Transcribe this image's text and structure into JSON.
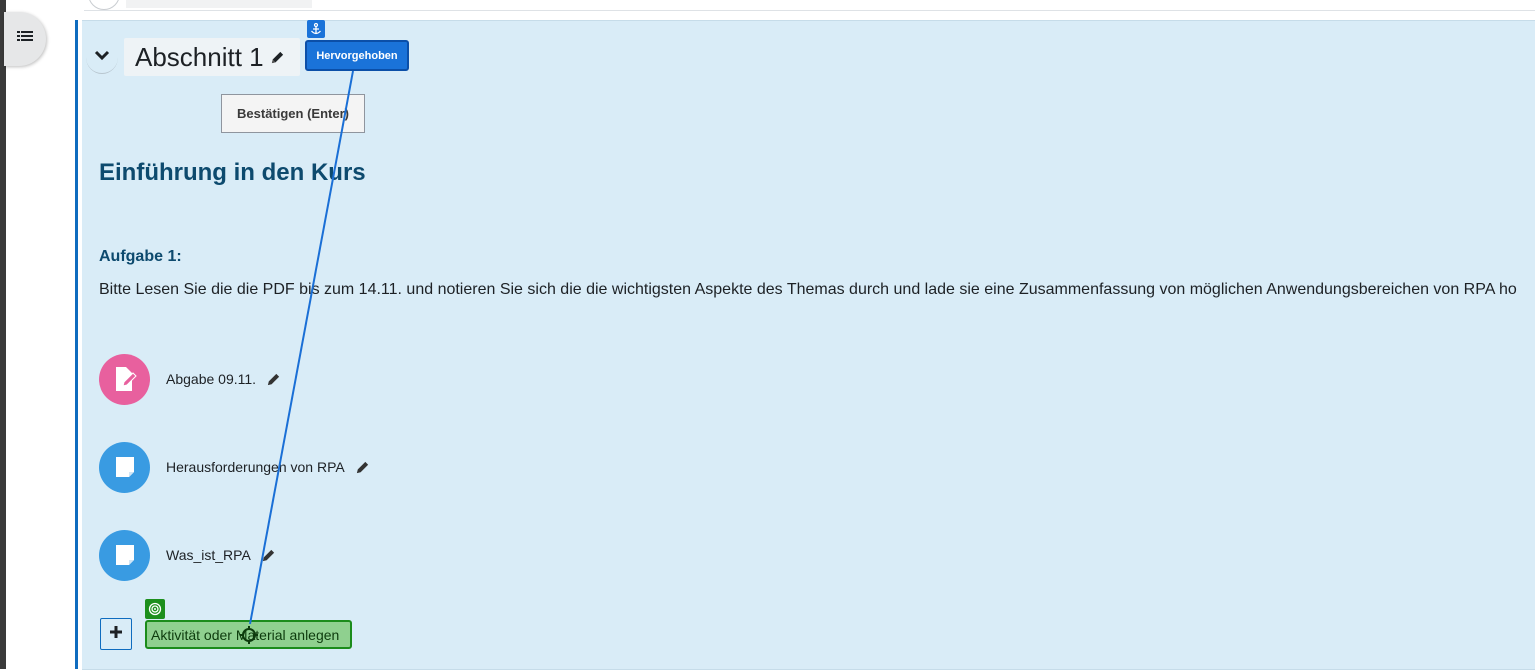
{
  "drawer": {
    "icon": "list-icon"
  },
  "section": {
    "title": "Abschnitt 1",
    "collapse_icon": "chevron-down-icon",
    "edit_icon": "pencil-icon",
    "highlight_badge": "Hervorgehoben",
    "anchor_icon": "anchor-icon",
    "confirm_tooltip": "Bestätigen (Enter)",
    "summary_heading": "Einführung in den Kurs",
    "task_label": "Aufgabe 1:",
    "task_text": "Bitte Lesen Sie die die PDF bis zum 14.11. und notieren Sie sich die die wichtigsten Aspekte des Themas durch und lade sie eine Zusammenfassung von möglichen Anwendungsbereichen von RPA ho"
  },
  "activities": [
    {
      "name": "Abgabe 09.11.",
      "icon": "assignment-icon",
      "color": "#e8609e"
    },
    {
      "name": "Herausforderungen von RPA",
      "icon": "page-icon",
      "color": "#399be2"
    },
    {
      "name": "Was_ist_RPA",
      "icon": "page-icon",
      "color": "#399be2"
    }
  ],
  "add_activity": {
    "label": "Aktivität oder Material anlegen",
    "button_icon": "plus-icon",
    "target_icon": "target-icon"
  },
  "colors": {
    "section_bg": "#d9ecf7",
    "accent": "#0f6cbf",
    "highlight": "#1a73d9",
    "drop_target": "#8fd08f"
  }
}
